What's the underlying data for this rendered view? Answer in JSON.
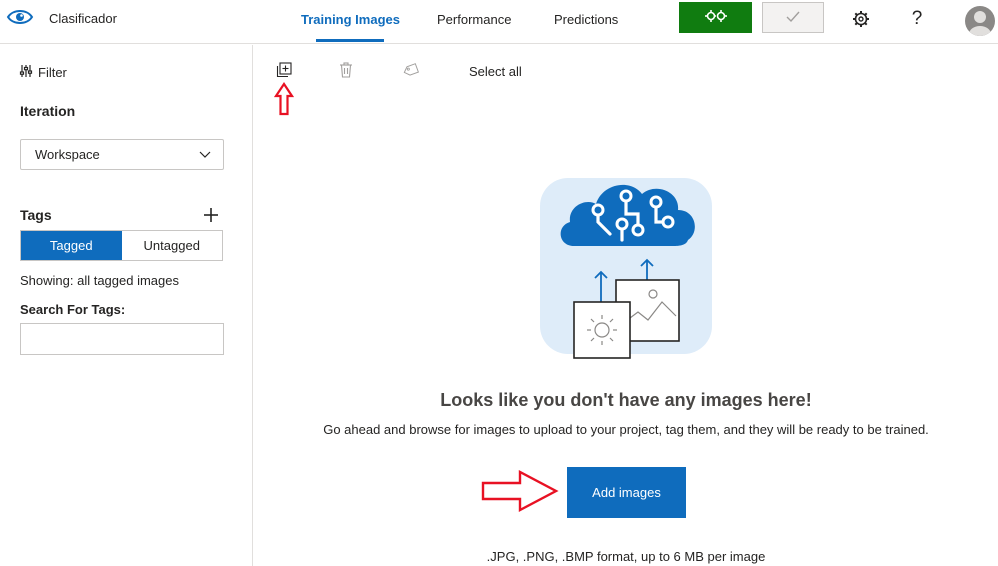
{
  "app": {
    "title": "Clasificador",
    "logo_icon": "eye-icon"
  },
  "nav": {
    "tabs": [
      {
        "label": "Training Images",
        "active": true
      },
      {
        "label": "Performance",
        "active": false
      },
      {
        "label": "Predictions",
        "active": false
      }
    ]
  },
  "header_actions": {
    "train_icon": "gears-icon",
    "quick_test_icon": "checkmark-icon",
    "settings_icon": "gear-icon",
    "help_label": "?",
    "avatar_icon": "user-avatar-icon"
  },
  "sidebar": {
    "filter_label": "Filter",
    "iteration_label": "Iteration",
    "iteration_value": "Workspace",
    "tags_label": "Tags",
    "segment": {
      "tagged": "Tagged",
      "untagged": "Untagged",
      "selected": "Tagged"
    },
    "showing_text": "Showing: all tagged images",
    "search_label": "Search For Tags:",
    "search_value": ""
  },
  "toolbar": {
    "add_icon": "add-images-icon",
    "delete_icon": "trash-icon",
    "tag_icon": "tag-icon",
    "select_all_label": "Select all"
  },
  "empty_state": {
    "title": "Looks like you don't have any images here!",
    "description": "Go ahead and browse for images to upload to your project, tag them, and they will be ready to be trained.",
    "button_label": "Add images",
    "formats_text": ".JPG, .PNG, .BMP format, up to 6 MB per image"
  },
  "colors": {
    "accent": "#0f6cbd",
    "train_green": "#107c10",
    "annotation_red": "#e81123",
    "hero_bg": "#deecf9"
  }
}
